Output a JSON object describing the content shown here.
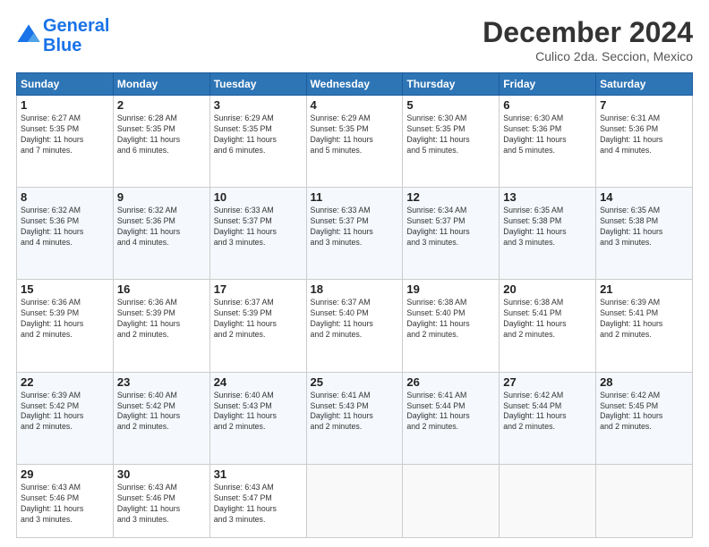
{
  "header": {
    "logo_line1": "General",
    "logo_line2": "Blue",
    "month": "December 2024",
    "location": "Culico 2da. Seccion, Mexico"
  },
  "days_of_week": [
    "Sunday",
    "Monday",
    "Tuesday",
    "Wednesday",
    "Thursday",
    "Friday",
    "Saturday"
  ],
  "weeks": [
    [
      {
        "day": "1",
        "info": "Sunrise: 6:27 AM\nSunset: 5:35 PM\nDaylight: 11 hours\nand 7 minutes."
      },
      {
        "day": "2",
        "info": "Sunrise: 6:28 AM\nSunset: 5:35 PM\nDaylight: 11 hours\nand 6 minutes."
      },
      {
        "day": "3",
        "info": "Sunrise: 6:29 AM\nSunset: 5:35 PM\nDaylight: 11 hours\nand 6 minutes."
      },
      {
        "day": "4",
        "info": "Sunrise: 6:29 AM\nSunset: 5:35 PM\nDaylight: 11 hours\nand 5 minutes."
      },
      {
        "day": "5",
        "info": "Sunrise: 6:30 AM\nSunset: 5:35 PM\nDaylight: 11 hours\nand 5 minutes."
      },
      {
        "day": "6",
        "info": "Sunrise: 6:30 AM\nSunset: 5:36 PM\nDaylight: 11 hours\nand 5 minutes."
      },
      {
        "day": "7",
        "info": "Sunrise: 6:31 AM\nSunset: 5:36 PM\nDaylight: 11 hours\nand 4 minutes."
      }
    ],
    [
      {
        "day": "8",
        "info": "Sunrise: 6:32 AM\nSunset: 5:36 PM\nDaylight: 11 hours\nand 4 minutes."
      },
      {
        "day": "9",
        "info": "Sunrise: 6:32 AM\nSunset: 5:36 PM\nDaylight: 11 hours\nand 4 minutes."
      },
      {
        "day": "10",
        "info": "Sunrise: 6:33 AM\nSunset: 5:37 PM\nDaylight: 11 hours\nand 3 minutes."
      },
      {
        "day": "11",
        "info": "Sunrise: 6:33 AM\nSunset: 5:37 PM\nDaylight: 11 hours\nand 3 minutes."
      },
      {
        "day": "12",
        "info": "Sunrise: 6:34 AM\nSunset: 5:37 PM\nDaylight: 11 hours\nand 3 minutes."
      },
      {
        "day": "13",
        "info": "Sunrise: 6:35 AM\nSunset: 5:38 PM\nDaylight: 11 hours\nand 3 minutes."
      },
      {
        "day": "14",
        "info": "Sunrise: 6:35 AM\nSunset: 5:38 PM\nDaylight: 11 hours\nand 3 minutes."
      }
    ],
    [
      {
        "day": "15",
        "info": "Sunrise: 6:36 AM\nSunset: 5:39 PM\nDaylight: 11 hours\nand 2 minutes."
      },
      {
        "day": "16",
        "info": "Sunrise: 6:36 AM\nSunset: 5:39 PM\nDaylight: 11 hours\nand 2 minutes."
      },
      {
        "day": "17",
        "info": "Sunrise: 6:37 AM\nSunset: 5:39 PM\nDaylight: 11 hours\nand 2 minutes."
      },
      {
        "day": "18",
        "info": "Sunrise: 6:37 AM\nSunset: 5:40 PM\nDaylight: 11 hours\nand 2 minutes."
      },
      {
        "day": "19",
        "info": "Sunrise: 6:38 AM\nSunset: 5:40 PM\nDaylight: 11 hours\nand 2 minutes."
      },
      {
        "day": "20",
        "info": "Sunrise: 6:38 AM\nSunset: 5:41 PM\nDaylight: 11 hours\nand 2 minutes."
      },
      {
        "day": "21",
        "info": "Sunrise: 6:39 AM\nSunset: 5:41 PM\nDaylight: 11 hours\nand 2 minutes."
      }
    ],
    [
      {
        "day": "22",
        "info": "Sunrise: 6:39 AM\nSunset: 5:42 PM\nDaylight: 11 hours\nand 2 minutes."
      },
      {
        "day": "23",
        "info": "Sunrise: 6:40 AM\nSunset: 5:42 PM\nDaylight: 11 hours\nand 2 minutes."
      },
      {
        "day": "24",
        "info": "Sunrise: 6:40 AM\nSunset: 5:43 PM\nDaylight: 11 hours\nand 2 minutes."
      },
      {
        "day": "25",
        "info": "Sunrise: 6:41 AM\nSunset: 5:43 PM\nDaylight: 11 hours\nand 2 minutes."
      },
      {
        "day": "26",
        "info": "Sunrise: 6:41 AM\nSunset: 5:44 PM\nDaylight: 11 hours\nand 2 minutes."
      },
      {
        "day": "27",
        "info": "Sunrise: 6:42 AM\nSunset: 5:44 PM\nDaylight: 11 hours\nand 2 minutes."
      },
      {
        "day": "28",
        "info": "Sunrise: 6:42 AM\nSunset: 5:45 PM\nDaylight: 11 hours\nand 2 minutes."
      }
    ],
    [
      {
        "day": "29",
        "info": "Sunrise: 6:43 AM\nSunset: 5:46 PM\nDaylight: 11 hours\nand 3 minutes."
      },
      {
        "day": "30",
        "info": "Sunrise: 6:43 AM\nSunset: 5:46 PM\nDaylight: 11 hours\nand 3 minutes."
      },
      {
        "day": "31",
        "info": "Sunrise: 6:43 AM\nSunset: 5:47 PM\nDaylight: 11 hours\nand 3 minutes."
      },
      {
        "day": "",
        "info": ""
      },
      {
        "day": "",
        "info": ""
      },
      {
        "day": "",
        "info": ""
      },
      {
        "day": "",
        "info": ""
      }
    ]
  ]
}
